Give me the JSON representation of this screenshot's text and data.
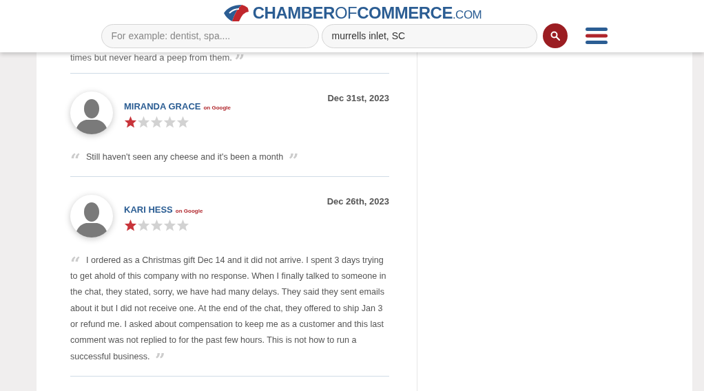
{
  "header": {
    "logo": [
      "CHAMBER",
      "OF",
      "COMMERCE",
      ".COM"
    ],
    "search": {
      "placeholder": "For example: dentist, spa...."
    },
    "location": {
      "value": "murrells inlet, SC"
    }
  },
  "previous_review_tail": {
    "text": "times but never heard a peep from them.",
    "quote_close": "”"
  },
  "reviews": [
    {
      "name": "MIRANDA GRACE",
      "source": "on Google",
      "date": "Dec 31st, 2023",
      "stars": 1,
      "quote_open": "“",
      "text": "Still haven't seen any cheese and it's been a month",
      "quote_close": "”"
    },
    {
      "name": "KARI HESS",
      "source": "on Google",
      "date": "Dec 26th, 2023",
      "stars": 1,
      "quote_open": "“",
      "text": "I ordered as a Christmas gift Dec 14 and it did not arrive. I spent 3 days trying to get ahold of this company with no response. When I finally talked to someone in the chat, they stated, sorry, we have had many delays. They said they sent emails about it but I did not receive one. At the end of the chat, they offered to ship Jan 3 or refund me. I asked about compensation to keep me as a customer and this last comment was not replied to for the past few hours. This is not how to run a successful business.",
      "quote_close": "”"
    }
  ]
}
